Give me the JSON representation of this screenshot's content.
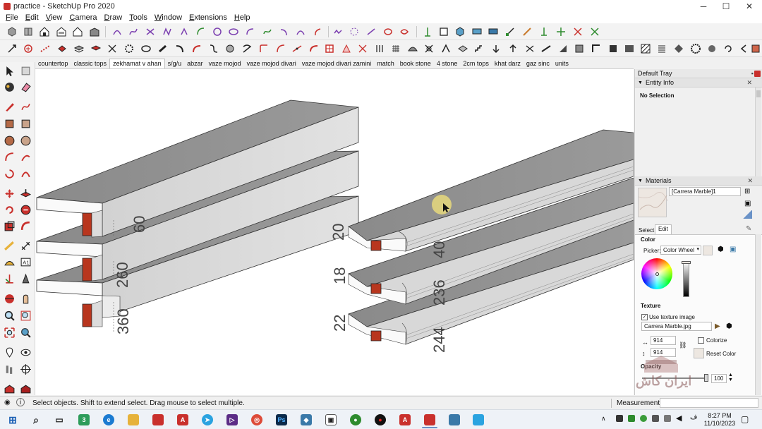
{
  "window": {
    "title": "practice - SketchUp Pro 2020",
    "minimize": "─",
    "maximize": "☐",
    "close": "✕"
  },
  "menu": [
    {
      "label": "File",
      "ul": "F",
      "rest": "ile"
    },
    {
      "label": "Edit",
      "ul": "E",
      "rest": "dit"
    },
    {
      "label": "View",
      "ul": "V",
      "rest": "iew"
    },
    {
      "label": "Camera",
      "ul": "C",
      "rest": "amera"
    },
    {
      "label": "Draw",
      "ul": "D",
      "rest": "raw"
    },
    {
      "label": "Tools",
      "ul": "T",
      "rest": "ools"
    },
    {
      "label": "Window",
      "ul": "W",
      "rest": "indow"
    },
    {
      "label": "Extensions",
      "ul": "E",
      "rest": "xtensions"
    },
    {
      "label": "Help",
      "ul": "H",
      "rest": "elp"
    }
  ],
  "scenes": [
    {
      "label": "countertop",
      "active": false
    },
    {
      "label": "classic tops",
      "active": false
    },
    {
      "label": "zekhamat v ahan",
      "active": true
    },
    {
      "label": "s/g/u",
      "active": false
    },
    {
      "label": "abzar",
      "active": false
    },
    {
      "label": "vaze mojod",
      "active": false
    },
    {
      "label": "vaze mojod divari",
      "active": false
    },
    {
      "label": "vaze mojod divari zamini",
      "active": false
    },
    {
      "label": "match",
      "active": false
    },
    {
      "label": "book stone",
      "active": false
    },
    {
      "label": "4 stone",
      "active": false
    },
    {
      "label": "2cm tops",
      "active": false
    },
    {
      "label": "khat darz",
      "active": false
    },
    {
      "label": "gaz sinc",
      "active": false
    },
    {
      "label": "units",
      "active": false
    }
  ],
  "dimensions": {
    "left": [
      "60",
      "260",
      "360"
    ],
    "right_heights": [
      "20",
      "18",
      "22"
    ],
    "right_depths": [
      "40",
      "236",
      "244"
    ]
  },
  "tray": {
    "title": "Default Tray",
    "entity_info": {
      "header": "Entity Info",
      "value": "No Selection"
    },
    "materials": {
      "header": "Materials",
      "name": "[Carrera Marble]1",
      "tab_select": "Select",
      "tab_edit": "Edit",
      "color_label": "Color",
      "picker_label": "Picker:",
      "picker_value": "Color Wheel",
      "texture_label": "Texture",
      "use_texture": "Use texture image",
      "texture_file": "Carrera Marble.jpg",
      "width": "914",
      "height": "914",
      "colorize": "Colorize",
      "reset_color": "Reset Color",
      "opacity_label": "Opacity",
      "opacity_value": "100"
    },
    "watermark": "ایران کاش"
  },
  "status": {
    "text": "Select objects. Shift to extend select. Drag mouse to select multiple.",
    "measurements_label": "Measurements"
  },
  "taskbar": {
    "time": "8:27 PM",
    "date": "11/10/2023",
    "badge": "3"
  },
  "colors": {
    "accent_red": "#c9302c",
    "slab_top": "#8f8f8f",
    "slab_face": "#d7d7d7",
    "support_red": "#b8361e"
  }
}
